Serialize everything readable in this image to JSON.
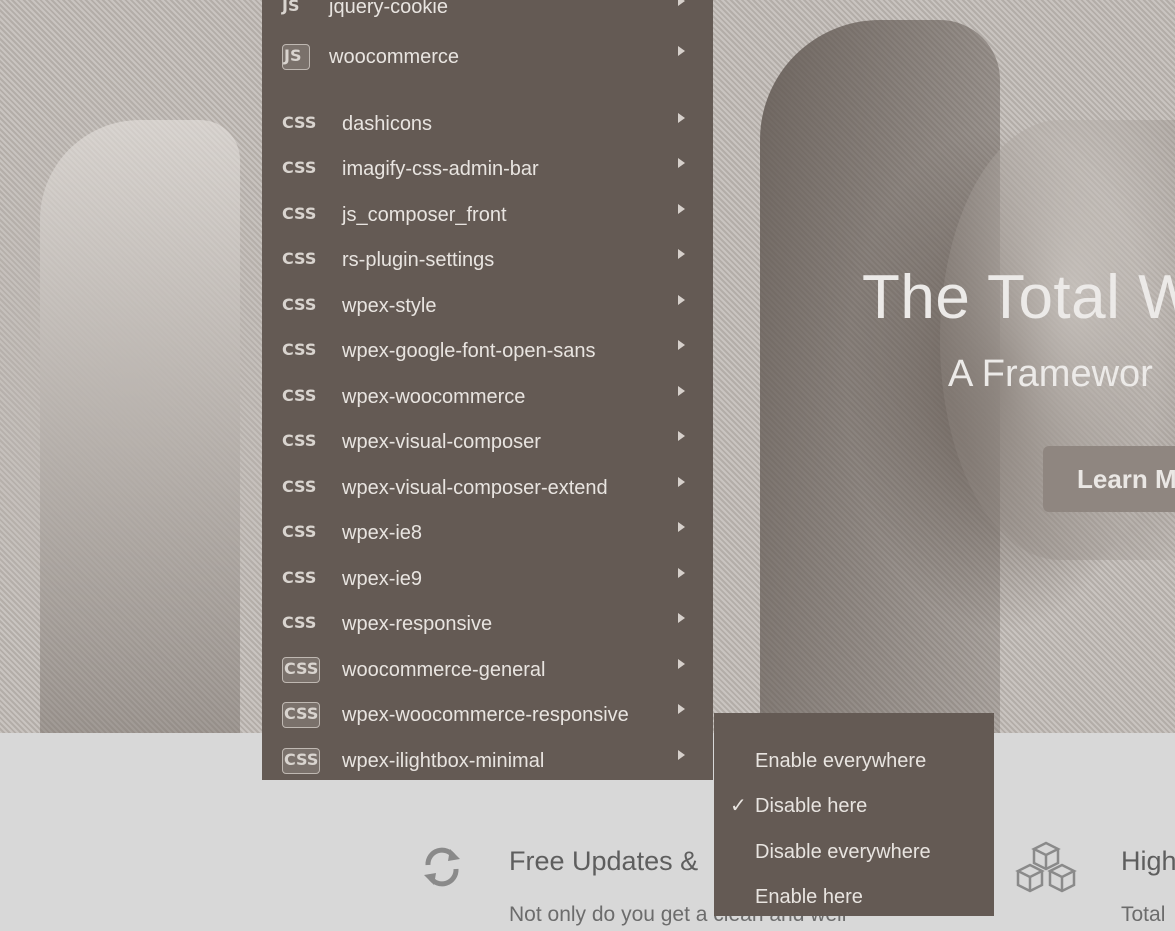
{
  "hero": {
    "title": "The Total W",
    "subtitle": "A Framewor",
    "button_label": "Learn M"
  },
  "menu": {
    "items": [
      {
        "type": "JS",
        "label": "jquery-cookie"
      },
      {
        "type": "JS",
        "label": "woocommerce"
      },
      {
        "type": "CSS",
        "label": "dashicons"
      },
      {
        "type": "CSS",
        "label": "imagify-css-admin-bar"
      },
      {
        "type": "CSS",
        "label": "js_composer_front"
      },
      {
        "type": "CSS",
        "label": "rs-plugin-settings"
      },
      {
        "type": "CSS",
        "label": "wpex-style"
      },
      {
        "type": "CSS",
        "label": "wpex-google-font-open-sans"
      },
      {
        "type": "CSS",
        "label": "wpex-woocommerce"
      },
      {
        "type": "CSS",
        "label": "wpex-visual-composer"
      },
      {
        "type": "CSS",
        "label": "wpex-visual-composer-extend"
      },
      {
        "type": "CSS",
        "label": "wpex-ie8"
      },
      {
        "type": "CSS",
        "label": "wpex-ie9"
      },
      {
        "type": "CSS",
        "label": "wpex-responsive"
      },
      {
        "type": "CSS",
        "label": "woocommerce-general"
      },
      {
        "type": "CSS",
        "label": "wpex-woocommerce-responsive"
      },
      {
        "type": "CSS",
        "label": "wpex-ilightbox-minimal"
      }
    ]
  },
  "submenu": {
    "items": [
      {
        "label": "Enable everywhere",
        "checked": false
      },
      {
        "label": "Disable here",
        "checked": true
      },
      {
        "label": "Disable everywhere",
        "checked": false
      },
      {
        "label": "Enable here",
        "checked": false
      }
    ],
    "check_glyph": "✓"
  },
  "features": {
    "first": {
      "title": "Free Updates &",
      "text": "Not only do you get a clean and well",
      "icon": "refresh-icon"
    },
    "second": {
      "title": "High",
      "text": "Total",
      "icon": "cubes-icon"
    }
  },
  "colors": {
    "menu_bg": "#645a54",
    "section_bg": "#d8d8d8"
  }
}
